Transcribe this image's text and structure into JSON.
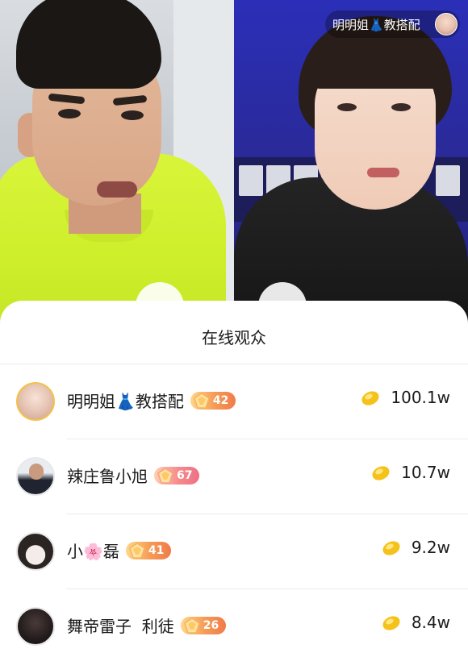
{
  "live": {
    "host_chip": {
      "name": "明明姐👗教搭配",
      "avatar_icon": "host-avatar"
    }
  },
  "audience_panel": {
    "title": "在线观众",
    "viewers": [
      {
        "name": "明明姐👗教搭配",
        "level": "42",
        "badge_color": "orange",
        "contribution": "100.1w",
        "avatar_style": "gold"
      },
      {
        "name": "辣庄鲁小旭",
        "level": "67",
        "badge_color": "pink",
        "contribution": "10.7w",
        "avatar_style": "plain"
      },
      {
        "name": "小🌸磊",
        "level": "41",
        "badge_color": "orange",
        "contribution": "9.2w",
        "avatar_style": "plain"
      },
      {
        "name": "舞帝雷子  利徒",
        "level": "26",
        "badge_color": "orange",
        "contribution": "8.4w",
        "avatar_style": "plain"
      }
    ],
    "coin_icon": "gold-ingot-icon"
  },
  "colors": {
    "badge_orange": "#f59a55",
    "badge_pink": "#ef6f86",
    "coin_gold": "#f5c21c"
  }
}
